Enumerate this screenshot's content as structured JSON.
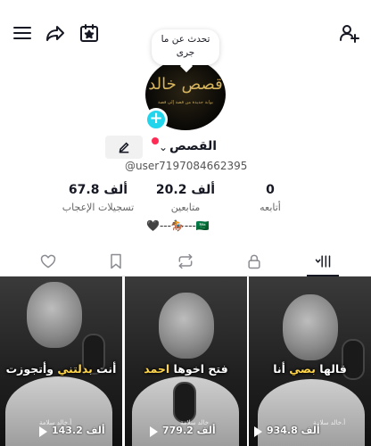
{
  "bubble": {
    "line1": "تحدث عن ما",
    "line2": "جرى"
  },
  "avatar": {
    "logo_text": "قصص خالد",
    "logo_sub": "بوابة جديدة من قصة إلى قصة"
  },
  "profile": {
    "name": "القصص",
    "handle": "@user7197084662395",
    "bio": "🖤---🏇---🇸🇦"
  },
  "stats": [
    {
      "value": "0",
      "label": "أتابعه"
    },
    {
      "value": "20.2 ألف",
      "label": "متابعين"
    },
    {
      "value": "67.8 ألف",
      "label": "تسجيلات الإعجاب"
    }
  ],
  "videos": [
    {
      "caption_pre": "قالها ",
      "caption_hl": "بصي",
      "caption_post": " أنا",
      "credit": "أ.خالد سلامة",
      "views": "934.8 ألف"
    },
    {
      "caption_pre": "فتح اخوها ",
      "caption_hl": "احمد",
      "caption_post": "",
      "credit": "خالد سلامة",
      "views": "779.2 ألف"
    },
    {
      "caption_pre": "أنت ",
      "caption_hl": "بدلتني",
      "caption_post": " وأتجوزت",
      "credit": "أ.خالد سلامة",
      "views": "143.2 ألف"
    }
  ],
  "colors": {
    "accent": "#20d5ec",
    "notification": "#fe2c55",
    "caption_highlight": "#ffd54a"
  }
}
